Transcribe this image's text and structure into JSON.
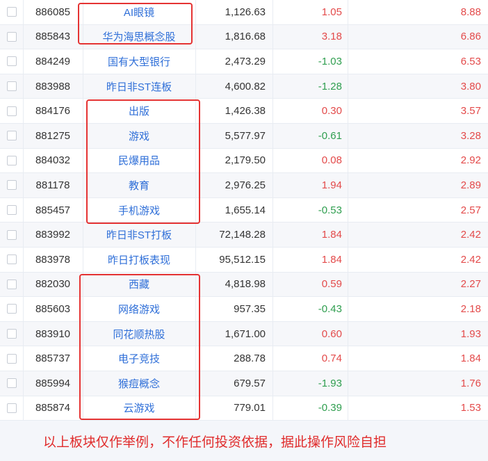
{
  "rows": [
    {
      "code": "886085",
      "name": "AI眼镜",
      "price": "1,126.63",
      "change": "1.05",
      "rate": "8.88",
      "dir": "up"
    },
    {
      "code": "885843",
      "name": "华为海思概念股",
      "price": "1,816.68",
      "change": "3.18",
      "rate": "6.86",
      "dir": "up"
    },
    {
      "code": "884249",
      "name": "国有大型银行",
      "price": "2,473.29",
      "change": "-1.03",
      "rate": "6.53",
      "dir": "down"
    },
    {
      "code": "883988",
      "name": "昨日非ST连板",
      "price": "4,600.82",
      "change": "-1.28",
      "rate": "3.80",
      "dir": "down"
    },
    {
      "code": "884176",
      "name": "出版",
      "price": "1,426.38",
      "change": "0.30",
      "rate": "3.57",
      "dir": "up"
    },
    {
      "code": "881275",
      "name": "游戏",
      "price": "5,577.97",
      "change": "-0.61",
      "rate": "3.28",
      "dir": "down"
    },
    {
      "code": "884032",
      "name": "民爆用品",
      "price": "2,179.50",
      "change": "0.08",
      "rate": "2.92",
      "dir": "up"
    },
    {
      "code": "881178",
      "name": "教育",
      "price": "2,976.25",
      "change": "1.94",
      "rate": "2.89",
      "dir": "up"
    },
    {
      "code": "885457",
      "name": "手机游戏",
      "price": "1,655.14",
      "change": "-0.53",
      "rate": "2.57",
      "dir": "down"
    },
    {
      "code": "883992",
      "name": "昨日非ST打板",
      "price": "72,148.28",
      "change": "1.84",
      "rate": "2.42",
      "dir": "up"
    },
    {
      "code": "883978",
      "name": "昨日打板表现",
      "price": "95,512.15",
      "change": "1.84",
      "rate": "2.42",
      "dir": "up"
    },
    {
      "code": "882030",
      "name": "西藏",
      "price": "4,818.98",
      "change": "0.59",
      "rate": "2.27",
      "dir": "up"
    },
    {
      "code": "885603",
      "name": "网络游戏",
      "price": "957.35",
      "change": "-0.43",
      "rate": "2.18",
      "dir": "down"
    },
    {
      "code": "883910",
      "name": "同花顺热股",
      "price": "1,671.00",
      "change": "0.60",
      "rate": "1.93",
      "dir": "up"
    },
    {
      "code": "885737",
      "name": "电子竞技",
      "price": "288.78",
      "change": "0.74",
      "rate": "1.84",
      "dir": "up"
    },
    {
      "code": "885994",
      "name": "猴痘概念",
      "price": "679.57",
      "change": "-1.93",
      "rate": "1.76",
      "dir": "down"
    },
    {
      "code": "885874",
      "name": "云游戏",
      "price": "779.01",
      "change": "-0.39",
      "rate": "1.53",
      "dir": "down"
    }
  ],
  "footer": {
    "disclaimer": "以上板块仅作举例，不作任何投资依据，据此操作风险自担"
  },
  "colors": {
    "up": "#e34a4a",
    "down": "#2f9e4f",
    "link": "#2f6fd8",
    "highlight": "#e53333"
  }
}
